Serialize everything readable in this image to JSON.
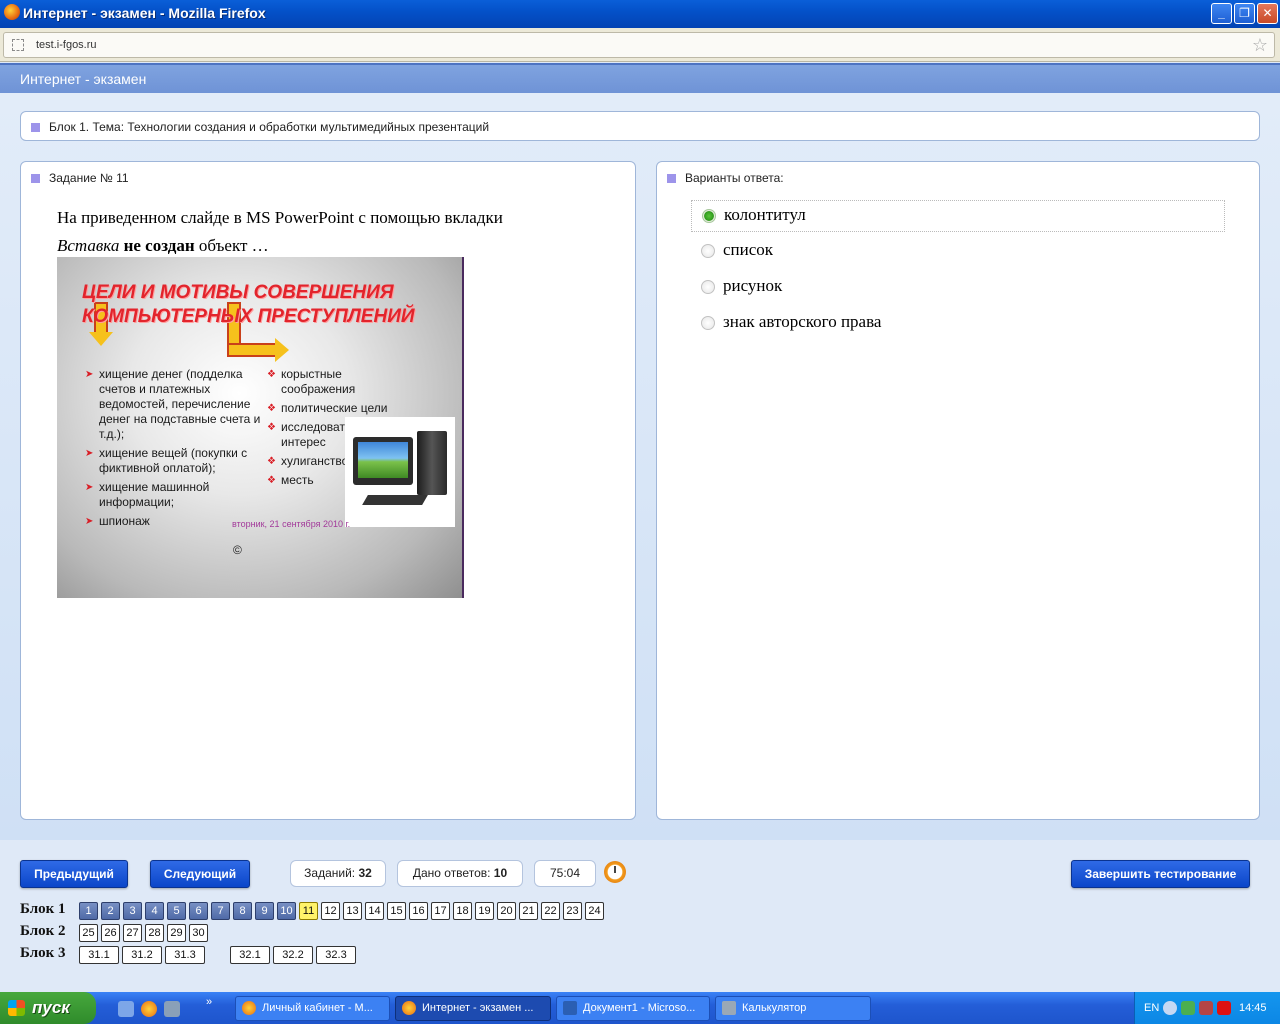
{
  "window": {
    "title": "Интернет - экзамен - Mozilla Firefox"
  },
  "browser": {
    "url": "test.i-fgos.ru"
  },
  "page": {
    "header": "Интернет - экзамен"
  },
  "block": {
    "label": "Блок 1. Тема: Технологии создания и обработки мультимедийных презентаций"
  },
  "task": {
    "label": "Задание № 11",
    "question_line1": "На приведенном слайде в MS PowerPoint с помощью вкладки",
    "question_italic": "Вставка",
    "question_bold": "не создан",
    "question_tail": "объект …",
    "slide": {
      "title": "ЦЕЛИ И МОТИВЫ СОВЕРШЕНИЯ КОМПЬЮТЕРНЫХ ПРЕСТУПЛЕНИЙ",
      "left_items": [
        "хищение денег (подделка счетов и платежных ведомостей, перечисление денег на подставные счета и т.д.);",
        "хищение вещей (покупки с фиктивной оплатой);",
        "хищение машинной информации;",
        "шпионаж"
      ],
      "right_items": [
        "корыстные соображения",
        "политические цели",
        "исследовательский интерес",
        "хулиганство",
        "месть"
      ],
      "date": "вторник, 21 сентября 2010 г.",
      "copyright": "©"
    }
  },
  "answers": {
    "label": "Варианты ответа:",
    "options": [
      "колонтитул",
      "список",
      "рисунок",
      "знак авторского права"
    ],
    "selected_index": 0
  },
  "controls": {
    "prev": "Предыдущий",
    "next": "Следующий",
    "finish": "Завершить тестирование",
    "total_label": "Заданий:",
    "total_value": "32",
    "given_label": "Дано ответов:",
    "given_value": "10",
    "timer": "75:04"
  },
  "nav": {
    "blocks": [
      {
        "label": "Блок 1",
        "items": [
          "1",
          "2",
          "3",
          "4",
          "5",
          "6",
          "7",
          "8",
          "9",
          "10",
          "11",
          "12",
          "13",
          "14",
          "15",
          "16",
          "17",
          "18",
          "19",
          "20",
          "21",
          "22",
          "23",
          "24"
        ],
        "answered": 10,
        "current": "11"
      },
      {
        "label": "Блок 2",
        "items": [
          "25",
          "26",
          "27",
          "28",
          "29",
          "30"
        ]
      },
      {
        "label": "Блок 3",
        "items": [
          "31.1",
          "31.2",
          "31.3",
          "32.1",
          "32.2",
          "32.3"
        ]
      }
    ]
  },
  "taskbar": {
    "start": "пуск",
    "tasks": [
      "Личный кабинет - М...",
      "Интернет - экзамен ...",
      "Документ1 - Microso...",
      "Калькулятор"
    ],
    "active_task": 1,
    "lang": "EN",
    "time": "14:45"
  }
}
